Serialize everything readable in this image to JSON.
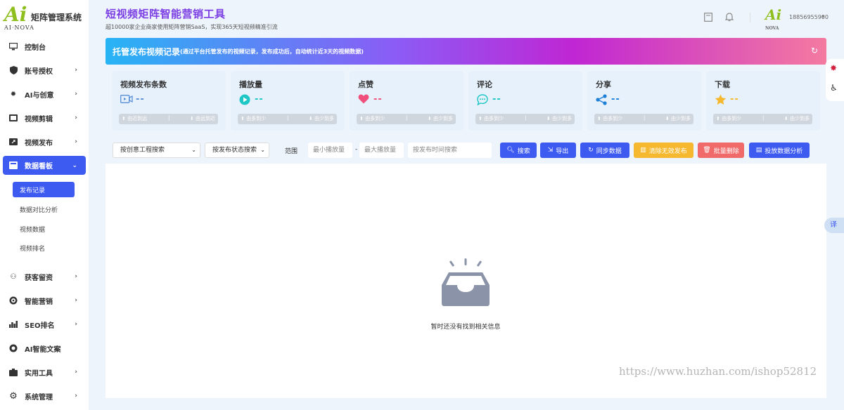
{
  "sidebar": {
    "logo_title": "矩阵管理系统",
    "logo_mark": "Ai",
    "logo_sub": "AI·NOVA",
    "items": [
      {
        "label": "控制台",
        "icon": "monitor-icon"
      },
      {
        "label": "账号授权",
        "icon": "shield-icon"
      },
      {
        "label": "AI与创意",
        "icon": "bulb-icon"
      },
      {
        "label": "视频剪辑",
        "icon": "film-icon"
      },
      {
        "label": "视频发布",
        "icon": "publish-icon"
      },
      {
        "label": "数据看板",
        "icon": "dashboard-icon"
      },
      {
        "label": "获客留资",
        "icon": "users-icon"
      },
      {
        "label": "智能营销",
        "icon": "target-icon"
      },
      {
        "label": "SEO排名",
        "icon": "chart-icon"
      },
      {
        "label": "AI智能文案",
        "icon": "ai-icon"
      },
      {
        "label": "实用工具",
        "icon": "toolbox-icon"
      },
      {
        "label": "系统管理",
        "icon": "gear-icon"
      }
    ],
    "sub_items": [
      "发布记录",
      "数据对比分析",
      "视频数据",
      "视频排名"
    ]
  },
  "header": {
    "title": "短视频矩阵智能营销工具",
    "subtitle": "超10000家企业商家使用矩阵营销SaaS，实现365天短视频精准引流",
    "user_phone": "18856955900",
    "avatar_mark": "Ai",
    "avatar_sub": "NOVA"
  },
  "banner": {
    "title": "托管发布视频记录",
    "note": "(通过平台托管发布的视频记录，发布成功后，自动统计近3天的视频数据)"
  },
  "stats": [
    {
      "title": "视频发布条数",
      "value": "--",
      "left_label": "由近到远",
      "right_label": "由远到近",
      "color": "#5a8fd6"
    },
    {
      "title": "播放量",
      "value": "--",
      "left_label": "由多到少",
      "right_label": "由少到多",
      "color": "#1ec6c6"
    },
    {
      "title": "点赞",
      "value": "--",
      "left_label": "由多到少",
      "right_label": "由少到多",
      "color": "#ef4f7a"
    },
    {
      "title": "评论",
      "value": "--",
      "left_label": "由多到少",
      "right_label": "由少到多",
      "color": "#1ec6c6"
    },
    {
      "title": "分享",
      "value": "--",
      "left_label": "由多到少",
      "right_label": "由少到多",
      "color": "#1e7fd6"
    },
    {
      "title": "下载",
      "value": "--",
      "left_label": "由多到少",
      "right_label": "由少到多",
      "color": "#f5b82e"
    }
  ],
  "filters": {
    "project_select": "按创意工程搜索",
    "status_select": "按发布状态搜索",
    "range_label": "范围",
    "min_play_placeholder": "最小播放量",
    "max_play_placeholder": "最大播放量",
    "time_placeholder": "按发布时间搜索",
    "range_dash": "-"
  },
  "buttons": {
    "search": "搜索",
    "export": "导出",
    "sync": "同步数据",
    "clear_invalid": "清除无效发布",
    "batch_delete": "批量删除",
    "analysis": "投放数据分析"
  },
  "empty_text": "暂时还没有找到相关信息",
  "float": {
    "translate": "译"
  },
  "watermark": "https://www.huzhan.com/ishop52812",
  "colors": {
    "primary": "#3d5af1",
    "warning": "#f5b82e",
    "danger": "#f06a6a"
  }
}
